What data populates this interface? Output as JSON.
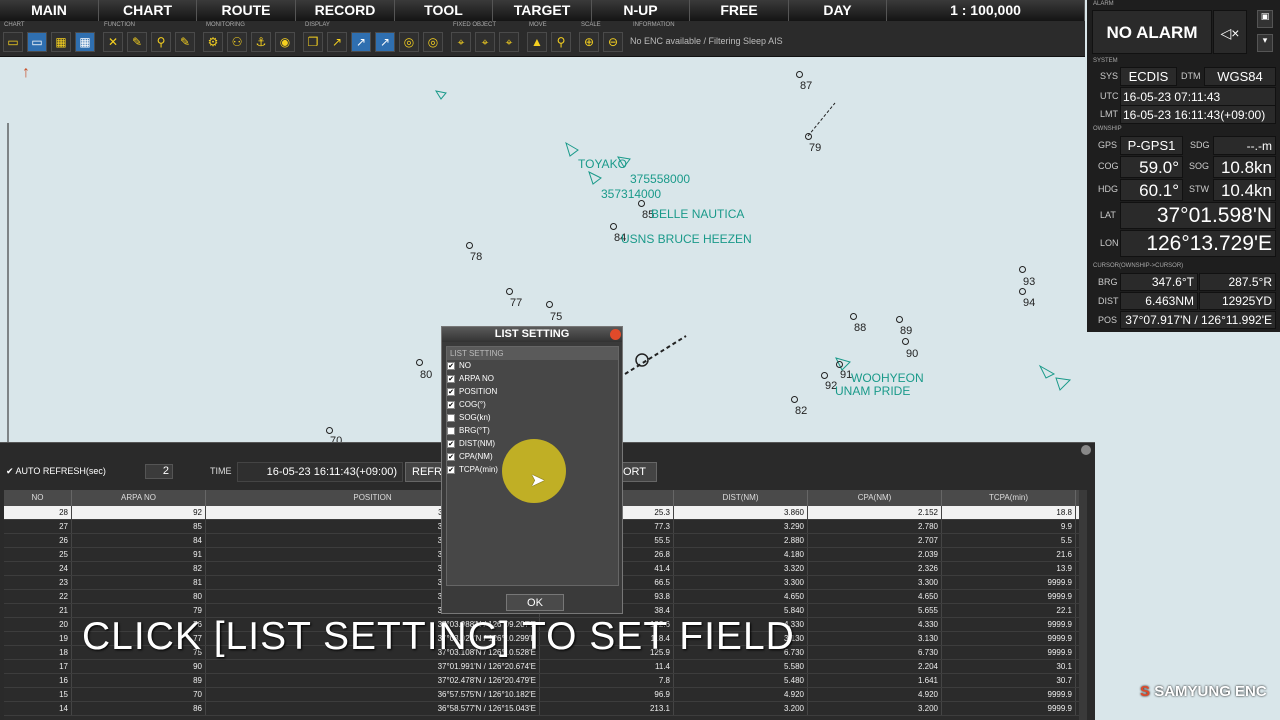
{
  "menu": [
    "MAIN",
    "CHART",
    "ROUTE",
    "RECORD",
    "TOOL",
    "TARGET",
    "N-UP",
    "FREE",
    "DAY",
    "1 : 100,000"
  ],
  "toolbar_groups": [
    "CHART",
    "FUNCTION",
    "MONITORING",
    "DISPLAY",
    "FIXED OBJECT",
    "MOVE",
    "SCALE",
    "INFORMATION"
  ],
  "info_text": "No ENC available / Filtering Sleep AIS",
  "alarm": {
    "label": "ALARM",
    "status": "NO ALARM"
  },
  "system": {
    "label": "SYSTEM",
    "sys_k": "SYS",
    "sys": "ECDIS",
    "dtm_k": "DTM",
    "dtm": "WGS84",
    "utc_k": "UTC",
    "utc": "16-05-23 07:11:43",
    "lmt_k": "LMT",
    "lmt": "16-05-23 16:11:43(+09:00)"
  },
  "ownship": {
    "label": "OWNSHIP",
    "gps_k": "GPS",
    "gps": "P-GPS1",
    "sdg_k": "SDG",
    "sdg": "--.-m",
    "cog_k": "COG",
    "cog": "59.0°",
    "sog_k": "SOG",
    "sog": "10.8kn",
    "hdg_k": "HDG",
    "hdg": "60.1°",
    "stw_k": "STW",
    "stw": "10.4kn",
    "lat_k": "LAT",
    "lat": "37°01.598'N",
    "lon_k": "LON",
    "lon": "126°13.729'E"
  },
  "cursor": {
    "label": "CURSOR(OWNSHIP->CURSOR)",
    "brg_k": "BRG",
    "brg_t": "347.6°T",
    "brg_r": "287.5°R",
    "dist_k": "DIST",
    "dist_nm": "6.463NM",
    "dist_yd": "12925YD",
    "pos_k": "POS",
    "pos": "37°07.917'N / 126°11.992'E"
  },
  "map_numbers": [
    "87",
    "79",
    "85",
    "84",
    "78",
    "77",
    "75",
    "80",
    "88",
    "89",
    "90",
    "93",
    "94",
    "91",
    "92",
    "82",
    "70"
  ],
  "map_labels": [
    "TOYAKO",
    "375558000",
    "357314000",
    "BELLE NAUTICA",
    "USNS BRUCE HEEZEN",
    "WOOHYEON",
    "UNAM PRIDE"
  ],
  "list": {
    "auto_refresh": "AUTO REFRESH(sec)",
    "refresh_val": "2",
    "time_label": "TIME",
    "time_val": "16-05-23 16:11:43(+09:00)",
    "refresh_btn": "REFR",
    "export_btn": "ORT",
    "columns": [
      "NO",
      "ARPA NO",
      "POSITION",
      "",
      "DIST(NM)",
      "CPA(NM)",
      "TCPA(min)"
    ],
    "rows": [
      [
        "28",
        "92",
        "37°01.311'N / 126°18.529'E",
        "25.3",
        "3.860",
        "2.152",
        "18.8"
      ],
      [
        "27",
        "85",
        "37°04.895'N / 126°13.708'E",
        "77.3",
        "3.290",
        "2.780",
        "9.9"
      ],
      [
        "26",
        "84",
        "37°04.422'N / 126°12.974'E",
        "55.5",
        "2.880",
        "2.707",
        "5.5"
      ],
      [
        "25",
        "91",
        "37°01.557'N / 126°18.942'E",
        "26.8",
        "4.180",
        "2.039",
        "21.6"
      ],
      [
        "24",
        "82",
        "37°00.769'N / 126°17.736'E",
        "41.4",
        "3.320",
        "2.326",
        "13.9"
      ],
      [
        "23",
        "81",
        "36°58.303'N / 126°13.471'E",
        "66.5",
        "3.300",
        "3.300",
        "9999.9"
      ],
      [
        "22",
        "80",
        "37°01.552'N / 126°07.916'E",
        "93.8",
        "4.650",
        "4.650",
        "9999.9"
      ],
      [
        "21",
        "79",
        "37°06.295'N / 126°18.073'E",
        "38.4",
        "5.840",
        "5.655",
        "22.1"
      ],
      [
        "20",
        "76",
        "37°03.988'N / 126°09.207'E",
        "132.6",
        "4.330",
        "4.330",
        "9999.9"
      ],
      [
        "19",
        "77",
        "37°03.028'N / 126°10.299'E",
        "118.4",
        "3.130",
        "3.130",
        "9999.9"
      ],
      [
        "18",
        "75",
        "37°03.108'N / 126°10.528'E",
        "125.9",
        "6.730",
        "6.730",
        "9999.9"
      ],
      [
        "17",
        "90",
        "37°01.991'N / 126°20.674'E",
        "11.4",
        "5.580",
        "2.204",
        "30.1"
      ],
      [
        "16",
        "89",
        "37°02.478'N / 126°20.479'E",
        "7.8",
        "5.480",
        "1.641",
        "30.7"
      ],
      [
        "15",
        "70",
        "36°57.575'N / 126°10.182'E",
        "96.9",
        "4.920",
        "4.920",
        "9999.9"
      ],
      [
        "14",
        "86",
        "36°58.577'N / 126°15.043'E",
        "213.1",
        "3.200",
        "3.200",
        "9999.9"
      ]
    ]
  },
  "dialog": {
    "title": "LIST SETTING",
    "group": "LIST SETTING",
    "items": [
      {
        "label": "NO",
        "checked": true
      },
      {
        "label": "ARPA NO",
        "checked": true
      },
      {
        "label": "POSITION",
        "checked": true
      },
      {
        "label": "COG(°)",
        "checked": true
      },
      {
        "label": "SOG(kn)",
        "checked": false
      },
      {
        "label": "BRG(°T)",
        "checked": false
      },
      {
        "label": "DIST(NM)",
        "checked": true
      },
      {
        "label": "CPA(NM)",
        "checked": true
      },
      {
        "label": "TCPA(min)",
        "checked": true
      }
    ],
    "ok": "OK"
  },
  "caption": "CLICK [LIST SETTING] TO SET FIELD",
  "logo": "SAMYUNG ENC",
  "colors": {
    "accent": "#2f6fb0",
    "target": "#1a9a8a",
    "highlight": "#e8d21a"
  }
}
